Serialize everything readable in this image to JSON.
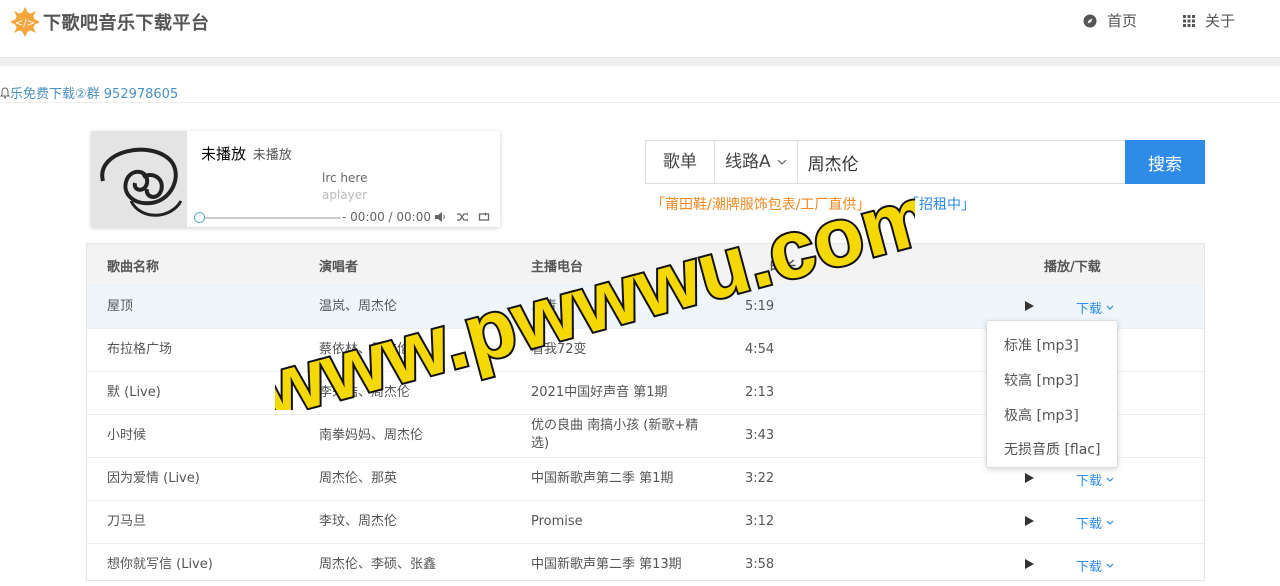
{
  "header": {
    "logo_text": "下歌吧音乐下载平台",
    "nav": [
      {
        "label": "首页",
        "icon": "compass-icon"
      },
      {
        "label": "关于",
        "icon": "grid-icon"
      }
    ]
  },
  "notice": "乐免费下载②群 952978605",
  "player": {
    "title": "未播放",
    "subtitle": "未播放",
    "lrc_line1": "lrc here",
    "lrc_line2": "aplayer",
    "time": "- 00:00 / 00:00"
  },
  "search": {
    "type_label": "歌单",
    "route_label": "线路A",
    "query": "周杰伦",
    "button_label": "搜索"
  },
  "ads": {
    "ad1": "「莆田鞋/潮牌服饰包表/工厂直供」",
    "ad2": "「招租中」"
  },
  "table": {
    "headers": [
      "歌曲名称",
      "演唱者",
      "主播电台",
      "时长",
      "播放/下载"
    ],
    "download_label": "下载",
    "rows": [
      {
        "song": "屋顶",
        "artist": "温岚、周杰伦",
        "album": "…青",
        "duration": "5:19"
      },
      {
        "song": "布拉格广场",
        "artist": "蔡依林、周杰伦",
        "album": "看我72变",
        "duration": "4:54"
      },
      {
        "song": "默 (Live)",
        "artist": "李荣浩、周杰伦",
        "album": "2021中国好声音 第1期",
        "duration": "2:13"
      },
      {
        "song": "小时候",
        "artist": "南拳妈妈、周杰伦",
        "album": "优の良曲 南搞小孩 (新歌+精选)",
        "duration": "3:43"
      },
      {
        "song": "因为爱情 (Live)",
        "artist": "周杰伦、那英",
        "album": "中国新歌声第二季 第1期",
        "duration": "3:22"
      },
      {
        "song": "刀马旦",
        "artist": "李玟、周杰伦",
        "album": "Promise",
        "duration": "3:12"
      },
      {
        "song": "想你就写信 (Live)",
        "artist": "周杰伦、李硕、张鑫",
        "album": "中国新歌声第二季 第13期",
        "duration": "3:58"
      }
    ]
  },
  "dropdown": [
    "标准 [mp3]",
    "较高 [mp3]",
    "极高 [mp3]",
    "无损音质 [flac]"
  ],
  "watermark": "www.pwwwu.com",
  "colors": {
    "accent": "#2f8be8",
    "ad_orange": "#f08a24",
    "watermark_fill": "#f5d800"
  }
}
